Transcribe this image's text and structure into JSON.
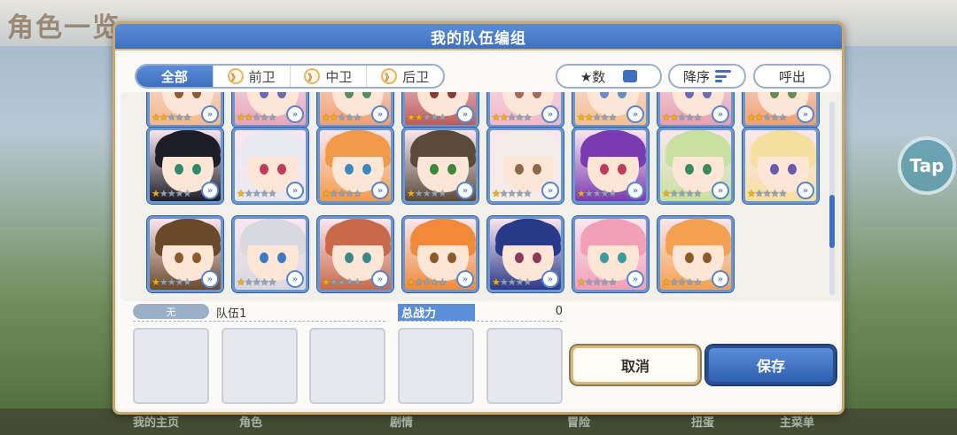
{
  "background": {
    "title": "角色一览",
    "tap_label": "Tap",
    "bottom_nav": [
      "我的主页",
      "角色",
      "剧情",
      "冒险",
      "扭蛋",
      "主菜单"
    ]
  },
  "dialog": {
    "title": "我的队伍编组",
    "tabs": [
      {
        "label": "全部",
        "icon": "",
        "active": true
      },
      {
        "label": "前卫",
        "icon": "》",
        "active": false
      },
      {
        "label": "中卫",
        "icon": "》",
        "active": false
      },
      {
        "label": "后卫",
        "icon": "》",
        "active": false
      }
    ],
    "sort_field_label": "★数",
    "sort_order_label": "降序",
    "call_label": "呼出",
    "team": {
      "none_label": "无",
      "name": "队伍1",
      "power_label": "总战力",
      "power_value": "0"
    },
    "buttons": {
      "cancel": "取消",
      "save": "保存"
    }
  },
  "characters": {
    "rows": [
      [
        {
          "hair": "#f4b88a",
          "eye": "#8a5a3a",
          "stars": 2
        },
        {
          "hair": "#e8a6b8",
          "eye": "#6a6ab0",
          "stars": 2
        },
        {
          "hair": "#f0a070",
          "eye": "#5a8a6a",
          "stars": 2
        },
        {
          "hair": "#c05a5a",
          "eye": "#8a3a3a",
          "stars": 2
        },
        {
          "hair": "#f2b8c8",
          "eye": "#a06a5a",
          "stars": 2
        },
        {
          "hair": "#f4c090",
          "eye": "#6a8ac0",
          "stars": 2
        },
        {
          "hair": "#e8a0b0",
          "eye": "#6a6ab0",
          "stars": 2
        },
        {
          "hair": "#f0a070",
          "eye": "#6a8a5a",
          "stars": 2
        }
      ],
      [
        {
          "hair": "#1e1e28",
          "eye": "#2f8a6a",
          "stars": 1
        },
        {
          "hair": "#e8e8f0",
          "eye": "#c03a5a",
          "stars": 1
        },
        {
          "hair": "#f29a4a",
          "eye": "#3a8ac0",
          "stars": 1
        },
        {
          "hair": "#5a4a3a",
          "eye": "#3a8a3a",
          "stars": 1
        },
        {
          "hair": "#f4ece6",
          "eye": "#8a6a4a",
          "stars": 1
        },
        {
          "hair": "#7a3ab0",
          "eye": "#c03a5a",
          "stars": 1
        },
        {
          "hair": "#c8e0a0",
          "eye": "#3a8a5a",
          "stars": 1
        },
        {
          "hair": "#f6e0a0",
          "eye": "#6a5ab0",
          "stars": 1
        }
      ],
      [
        {
          "hair": "#6a4a2a",
          "eye": "#8a5a2a",
          "stars": 1
        },
        {
          "hair": "#d8d8e0",
          "eye": "#3a7ac0",
          "stars": 1
        },
        {
          "hair": "#c86a4a",
          "eye": "#3a8a8a",
          "stars": 1
        },
        {
          "hair": "#f08a3a",
          "eye": "#8a5a2a",
          "stars": 1
        },
        {
          "hair": "#2a3a8a",
          "eye": "#8a3a5a",
          "stars": 1
        },
        {
          "hair": "#f2a0b8",
          "eye": "#3a9aa0",
          "stars": 1
        },
        {
          "hair": "#f4a050",
          "eye": "#8a5a2a",
          "stars": 1
        }
      ]
    ]
  }
}
